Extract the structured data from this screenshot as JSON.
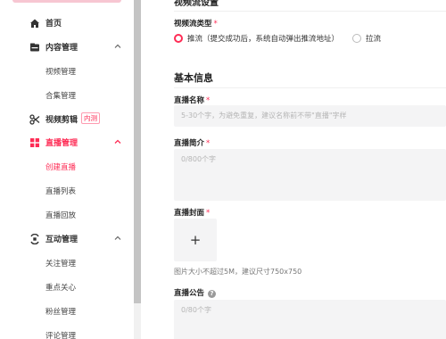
{
  "sidebar": {
    "items": [
      {
        "label": "首页",
        "icon": "home-icon"
      },
      {
        "label": "内容管理",
        "icon": "content-folder-icon",
        "expanded": true,
        "children": [
          {
            "label": "视频管理"
          },
          {
            "label": "合集管理"
          }
        ]
      },
      {
        "label": "视频剪辑",
        "icon": "scissors-icon",
        "badge": "内测"
      },
      {
        "label": "直播管理",
        "icon": "live-grid-icon",
        "expanded": true,
        "active": true,
        "children": [
          {
            "label": "创建直播",
            "active": true
          },
          {
            "label": "直播列表"
          },
          {
            "label": "直播回放"
          }
        ]
      },
      {
        "label": "互动管理",
        "icon": "interaction-icon",
        "expanded": true,
        "children": [
          {
            "label": "关注管理"
          },
          {
            "label": "重点关心"
          },
          {
            "label": "粉丝管理"
          },
          {
            "label": "评论管理"
          }
        ]
      }
    ]
  },
  "stream_settings": {
    "section_title": "视频流设置",
    "stream_type_label": "视频流类型",
    "options": [
      {
        "label": "推流（提交成功后，系统自动弹出推流地址）",
        "selected": true
      },
      {
        "label": "拉流",
        "selected": false
      }
    ]
  },
  "basic_info": {
    "section_title": "基本信息",
    "name_label": "直播名称",
    "name_placeholder": "5-30个字，为避免重复，建议名称前不带\"直播\"字样",
    "intro_label": "直播简介",
    "intro_placeholder": "0/800个字",
    "cover_label": "直播封面",
    "cover_upload_symbol": "+",
    "cover_hint": "图片大小不超过5M，建议尺寸750x750",
    "notice_label": "直播公告",
    "notice_placeholder": "0/80个字"
  },
  "required_mark": "*",
  "colors": {
    "accent": "#fe2c55",
    "input_bg": "#f4f4f5"
  }
}
